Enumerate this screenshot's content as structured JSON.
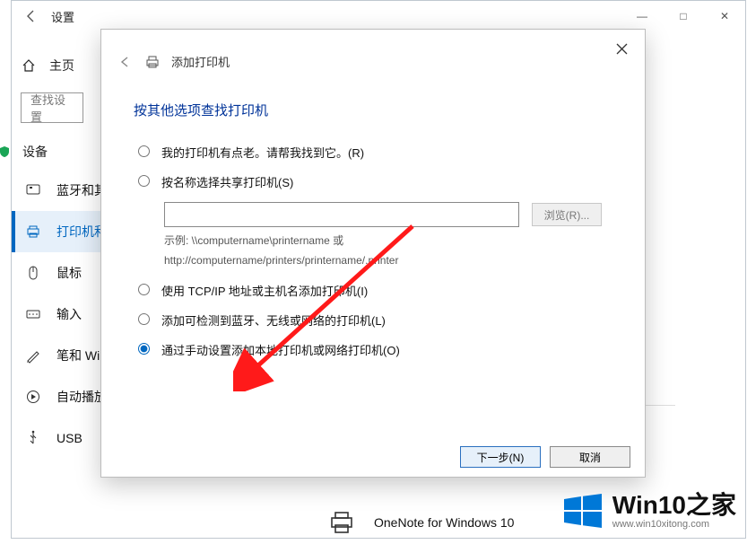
{
  "window": {
    "title": "设置",
    "sys_buttons": {
      "min": "—",
      "max": "□",
      "close": "✕"
    }
  },
  "sidebar": {
    "home": "主页",
    "search_placeholder": "查找设置",
    "group": "设备",
    "items": [
      {
        "label": "蓝牙和其他设备"
      },
      {
        "label": "打印机和扫描仪"
      },
      {
        "label": "鼠标"
      },
      {
        "label": "输入"
      },
      {
        "label": "笔和 Windows Ink"
      },
      {
        "label": "自动播放"
      },
      {
        "label": "USB"
      }
    ]
  },
  "content": {
    "printers": [
      {
        "label": "OneNote for Windows 10"
      }
    ]
  },
  "dialog": {
    "header": "添加打印机",
    "title": "按其他选项查找打印机",
    "options": {
      "old": "我的打印机有点老。请帮我找到它。(R)",
      "share": "按名称选择共享打印机(S)",
      "tcpip": "使用 TCP/IP 地址或主机名添加打印机(I)",
      "wireless": "添加可检测到蓝牙、无线或网络的打印机(L)",
      "manual": "通过手动设置添加本地打印机或网络打印机(O)"
    },
    "browse": "浏览(R)...",
    "hint1": "示例: \\\\computername\\printername 或",
    "hint2": "http://computername/printers/printername/.printer",
    "next": "下一步(N)",
    "cancel": "取消"
  },
  "watermark": {
    "brand": "Win10之家",
    "url": "www.win10xitong.com"
  }
}
